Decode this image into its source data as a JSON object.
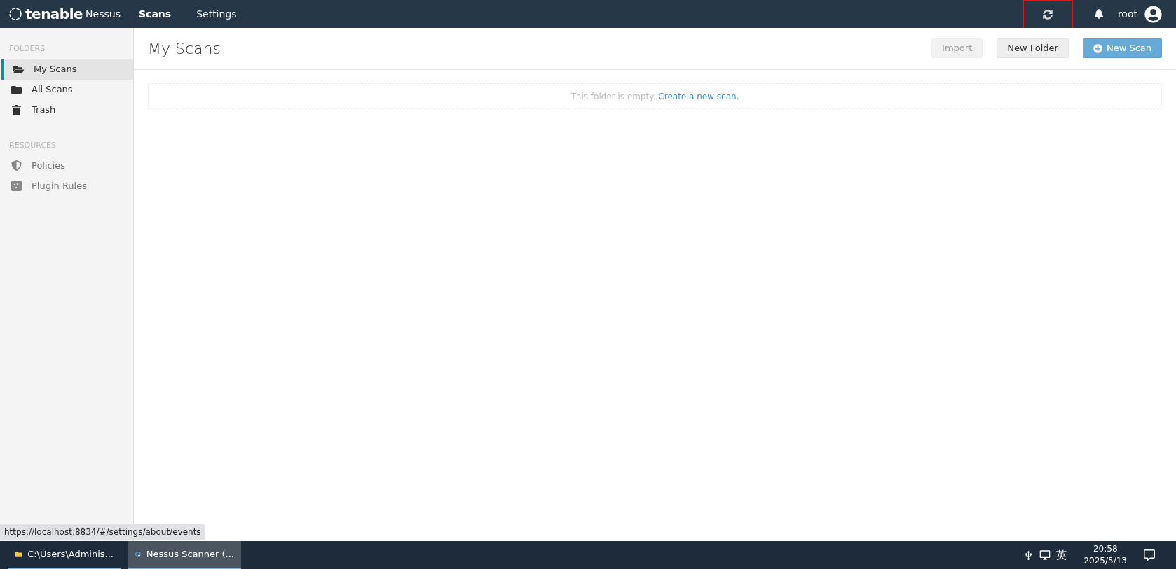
{
  "topbar": {
    "brand": "tenable",
    "product": "Nessus",
    "nav": [
      {
        "label": "Scans",
        "selected": true
      },
      {
        "label": "Settings",
        "selected": false
      }
    ],
    "user": "root"
  },
  "sidebar": {
    "sections": [
      {
        "heading": "FOLDERS",
        "items": [
          {
            "label": "My Scans",
            "kind": "open-folder",
            "selected": true
          },
          {
            "label": "All Scans",
            "kind": "folder",
            "selected": false
          },
          {
            "label": "Trash",
            "kind": "trash",
            "selected": false
          }
        ]
      },
      {
        "heading": "RESOURCES",
        "items": [
          {
            "label": "Policies",
            "kind": "policy",
            "selected": false
          },
          {
            "label": "Plugin Rules",
            "kind": "rule",
            "selected": false
          }
        ]
      }
    ]
  },
  "page": {
    "title": "My Scans",
    "buttons": [
      {
        "label": "Import",
        "kind": "disabled"
      },
      {
        "label": "New Folder",
        "kind": "default"
      },
      {
        "label": "New Scan",
        "kind": "primary"
      }
    ],
    "empty_text": "This folder is empty.",
    "empty_link": "Create a new scan."
  },
  "status_url": "https://localhost:8834/#/settings/about/events",
  "taskbar": {
    "apps": [
      {
        "label": "C:\\Users\\Adminis...",
        "kind": "explorer",
        "selected": false
      },
      {
        "label": "Nessus Scanner (...",
        "kind": "browser",
        "selected": true
      }
    ],
    "ime": "英",
    "time": "20:58",
    "date": "2025/5/13"
  }
}
